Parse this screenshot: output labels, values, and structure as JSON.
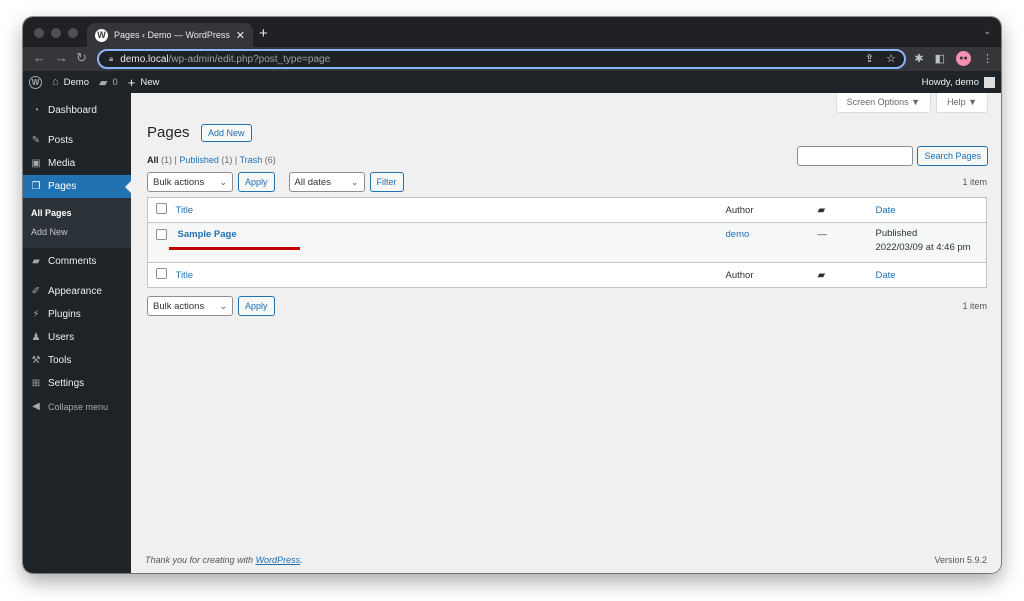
{
  "browser": {
    "tab_title": "Pages ‹ Demo — WordPress",
    "url_host": "demo.local",
    "url_path": "/wp-admin/edit.php?post_type=page"
  },
  "adminbar": {
    "site_name": "Demo",
    "comments_count": "0",
    "new_label": "New",
    "howdy": "Howdy, demo"
  },
  "sidebar": {
    "items": [
      {
        "label": "Dashboard",
        "icon": "dashboard-icon"
      },
      {
        "label": "Posts",
        "icon": "pin-icon"
      },
      {
        "label": "Media",
        "icon": "media-icon"
      },
      {
        "label": "Pages",
        "icon": "pages-icon"
      },
      {
        "label": "Comments",
        "icon": "comment-icon"
      },
      {
        "label": "Appearance",
        "icon": "brush-icon"
      },
      {
        "label": "Plugins",
        "icon": "plug-icon"
      },
      {
        "label": "Users",
        "icon": "user-icon"
      },
      {
        "label": "Tools",
        "icon": "wrench-icon"
      },
      {
        "label": "Settings",
        "icon": "sliders-icon"
      }
    ],
    "submenu": [
      "All Pages",
      "Add New"
    ],
    "collapse_label": "Collapse menu"
  },
  "header": {
    "screen_options": "Screen Options ▼",
    "help": "Help ▼",
    "title": "Pages",
    "add_new": "Add New"
  },
  "filters": {
    "all_label": "All",
    "all_count": "(1)",
    "published_label": "Published",
    "published_count": "(1)",
    "trash_label": "Trash",
    "trash_count": "(6)",
    "search_button": "Search Pages",
    "search_value": "",
    "bulk_actions": "Bulk actions",
    "apply": "Apply",
    "dates": "All dates",
    "filter": "Filter",
    "item_count": "1 item"
  },
  "table": {
    "columns": {
      "title": "Title",
      "author": "Author",
      "comments": "comments-icon",
      "date": "Date"
    },
    "rows": [
      {
        "title": "Sample Page",
        "author": "demo",
        "comments": "—",
        "status": "Published",
        "date": "2022/03/09 at 4:46 pm"
      }
    ]
  },
  "footer": {
    "thanks_prefix": "Thank you for creating with ",
    "thanks_link": "WordPress",
    "thanks_suffix": ".",
    "version": "Version 5.9.2"
  },
  "colors": {
    "accent": "#2271b1",
    "adminbar": "#1d2327",
    "highlight_line": "#c00000"
  }
}
